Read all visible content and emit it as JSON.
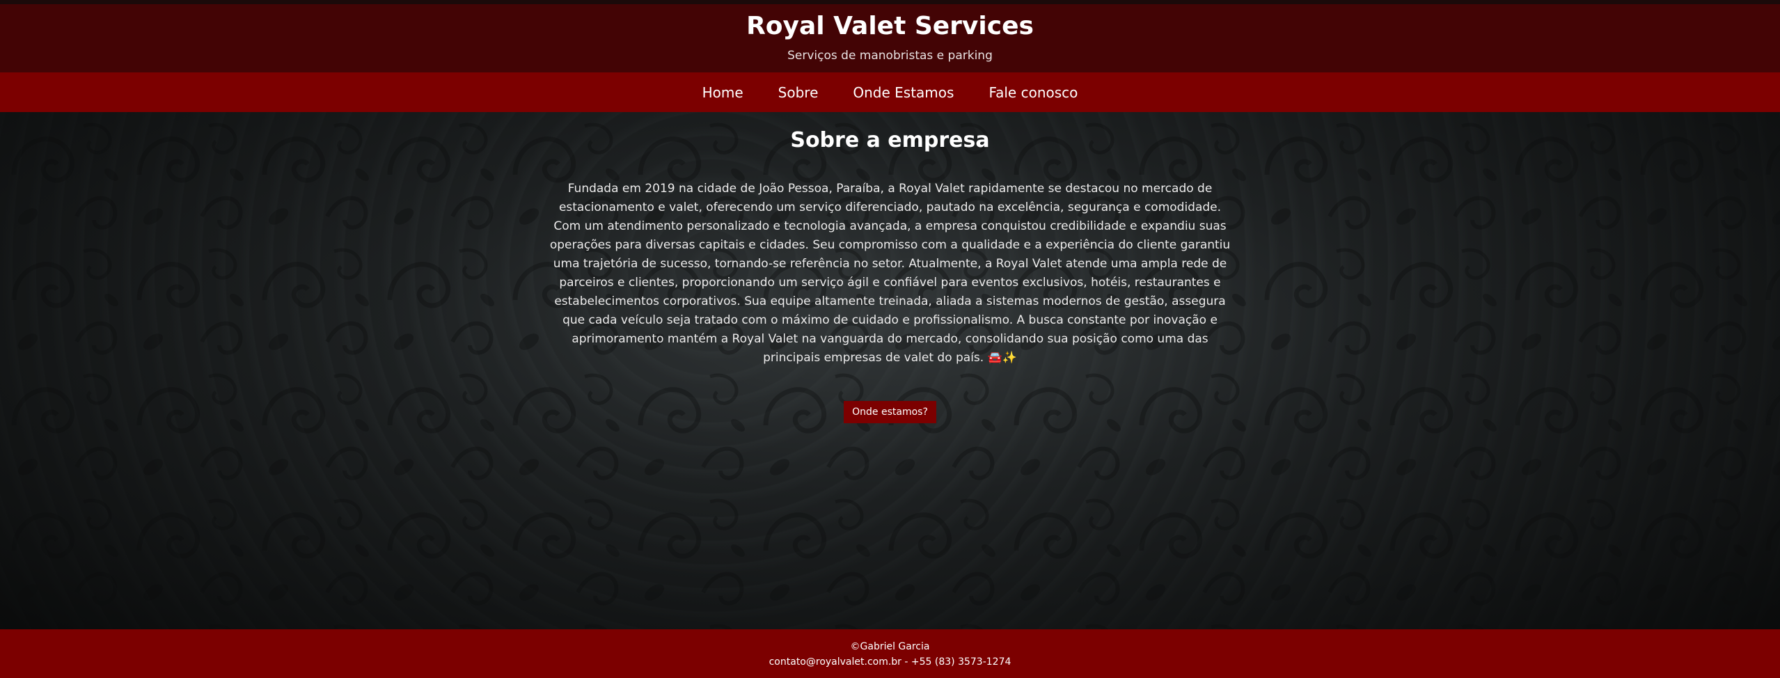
{
  "header": {
    "title": "Royal Valet Services",
    "subtitle": "Serviços de manobristas e parking"
  },
  "nav": {
    "items": [
      {
        "label": "Home"
      },
      {
        "label": "Sobre"
      },
      {
        "label": "Onde Estamos"
      },
      {
        "label": "Fale conosco"
      }
    ]
  },
  "main": {
    "section_title": "Sobre a empresa",
    "about_text": "Fundada em 2019 na cidade de João Pessoa, Paraíba, a Royal Valet rapidamente se destacou no mercado de estacionamento e valet, oferecendo um serviço diferenciado, pautado na excelência, segurança e comodidade. Com um atendimento personalizado e tecnologia avançada, a empresa conquistou credibilidade e expandiu suas operações para diversas capitais e cidades. Seu compromisso com a qualidade e a experiência do cliente garantiu uma trajetória de sucesso, tornando-se referência no setor. Atualmente, a Royal Valet atende uma ampla rede de parceiros e clientes, proporcionando um serviço ágil e confiável para eventos exclusivos, hotéis, restaurantes e estabelecimentos corporativos. Sua equipe altamente treinada, aliada a sistemas modernos de gestão, assegura que cada veículo seja tratado com o máximo de cuidado e profissionalismo. A busca constante por inovação e aprimoramento mantém a Royal Valet na vanguarda do mercado, consolidando sua posição como uma das principais empresas de valet do país. 🚘✨",
    "cta_label": "Onde estamos?"
  },
  "footer": {
    "copyright": "©Gabriel Garcia",
    "contact": "contato@royalvalet.com.br - +55 (83) 3573-1274"
  },
  "colors": {
    "header_bg": "#430405",
    "nav_bg": "#7c0000",
    "footer_bg": "#7c0000",
    "button_bg": "#7c0000"
  }
}
